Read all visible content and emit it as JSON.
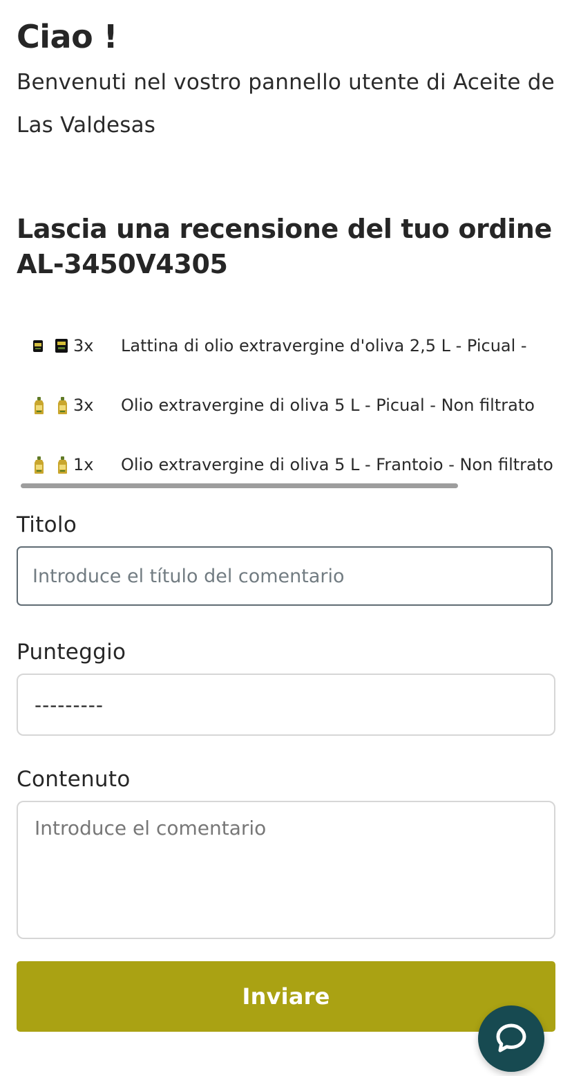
{
  "header": {
    "greeting": "Ciao !",
    "welcome": "Benvenuti nel vostro pannello utente di Aceite de Las Valdesas"
  },
  "review": {
    "title": "Lascia una recensione del tuo ordine",
    "order_code": "AL-3450V4305",
    "items": [
      {
        "quantity": "3x",
        "name": "Lattina di olio extravergine d'oliva 2,5 L - Picual -",
        "image": "olive-oil-can-image"
      },
      {
        "quantity": "3x",
        "name": "Olio extravergine di oliva 5 L - Picual - Non filtrato",
        "image": "olive-oil-bottle-image"
      },
      {
        "quantity": "1x",
        "name": "Olio extravergine di oliva 5 L - Frantoio - Non filtrato",
        "image": "olive-oil-bottle-image"
      }
    ]
  },
  "form": {
    "title_label": "Titolo",
    "title_placeholder": "Introduce el título del comentario",
    "score_label": "Punteggio",
    "score_value": "---------",
    "content_label": "Contenuto",
    "content_placeholder": "Introduce el comentario",
    "submit_label": "Inviare"
  },
  "chat": {
    "icon": "chat-bubble-icon"
  },
  "colors": {
    "primary_button": "#aaa213",
    "chat_button": "#174a51"
  }
}
